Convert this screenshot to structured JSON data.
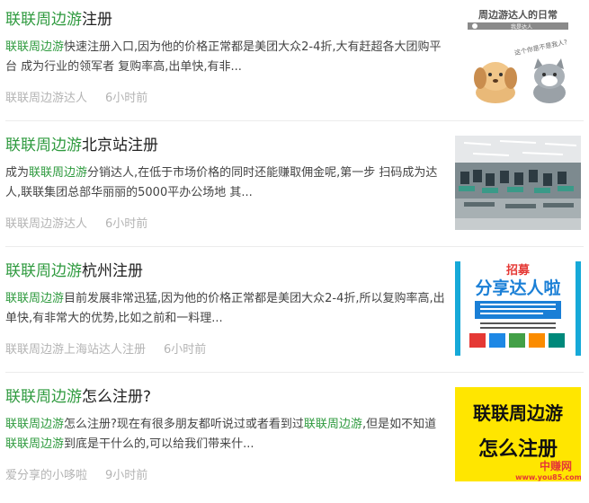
{
  "articles": [
    {
      "title_hl": "联联周边游",
      "title_rest": "注册",
      "summary_parts": [
        {
          "text": "联联周边游",
          "hl": true
        },
        {
          "text": "快速注册入口,因为他的价格正常都是美团大众2-4折,大有赶超各大团购平台 成为行业的领军者 复购率高,出单快,有非...",
          "hl": false
        }
      ],
      "author": "联联周边游达人",
      "time": "6小时前",
      "thumb": {
        "type": "cartoon",
        "caption": "周边游达人的日常",
        "bubble": "这个你是不是我人?",
        "note": "我是达人"
      }
    },
    {
      "title_hl": "联联周边游",
      "title_rest": "北京站注册",
      "summary_parts": [
        {
          "text": "成为",
          "hl": false
        },
        {
          "text": "联联周边游",
          "hl": true
        },
        {
          "text": "分销达人,在低于市场价格的同时还能赚取佣金呢,第一步 扫码成为达人,联联集团总部华丽丽的5000平办公场地 其...",
          "hl": false
        }
      ],
      "author": "联联周边游达人",
      "time": "6小时前",
      "thumb": {
        "type": "office"
      }
    },
    {
      "title_hl": "联联周边游",
      "title_rest": "杭州注册",
      "summary_parts": [
        {
          "text": "联联周边游",
          "hl": true
        },
        {
          "text": "目前发展非常迅猛,因为他的价格正常都是美团大众2-4折,所以复购率高,出单快,有非常大的优势,比如之前和一料理...",
          "hl": false
        }
      ],
      "author": "联联周边游上海站达人注册",
      "time": "6小时前",
      "thumb": {
        "type": "poster",
        "top": "招募",
        "headline": "分享达人啦"
      }
    },
    {
      "title_hl": "联联周边游",
      "title_rest": "怎么注册?",
      "summary_parts": [
        {
          "text": "联联周边游",
          "hl": true
        },
        {
          "text": "怎么注册?现在有很多朋友都听说过或者看到过",
          "hl": false
        },
        {
          "text": "联联周边游",
          "hl": true
        },
        {
          "text": ",但是如不知道",
          "hl": false
        },
        {
          "text": "联联周边游",
          "hl": true
        },
        {
          "text": "到底是干什么的,可以给我们带来什...",
          "hl": false
        }
      ],
      "author": "爱分享的小哆啦",
      "time": "9小时前",
      "thumb": {
        "type": "yellow",
        "line1": "联联周边游",
        "line2": "怎么注册",
        "watermark": "中赚网",
        "watermark_url": "www.you85.com"
      }
    }
  ],
  "colors": {
    "highlight": "#2e9a3e",
    "meta": "#b4b4b4",
    "yellow": "#ffe600"
  }
}
